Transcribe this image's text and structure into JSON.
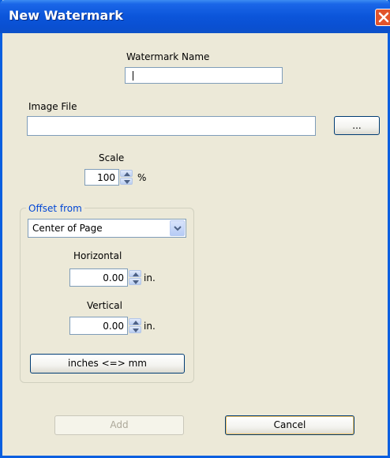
{
  "window": {
    "title": "New Watermark"
  },
  "name_field": {
    "label": "Watermark Name",
    "value": ""
  },
  "image_file": {
    "label": "Image File",
    "value": "",
    "browse_label": "..."
  },
  "scale": {
    "label": "Scale",
    "value": "100",
    "unit": "%"
  },
  "offset": {
    "group_label": "Offset from",
    "selected": "Center of Page",
    "horizontal": {
      "label": "Horizontal",
      "value": "0.00",
      "unit": "in."
    },
    "vertical": {
      "label": "Vertical",
      "value": "0.00",
      "unit": "in."
    },
    "convert_label": "inches <=> mm"
  },
  "buttons": {
    "add": "Add",
    "cancel": "Cancel"
  },
  "icons": {
    "close": "close-icon",
    "spin_up": "arrow-up-icon",
    "spin_down": "arrow-down-icon",
    "dropdown": "chevron-down-icon"
  },
  "colors": {
    "titlebar": "#0b55da",
    "close": "#e1542c",
    "group_label": "#0046d5"
  }
}
